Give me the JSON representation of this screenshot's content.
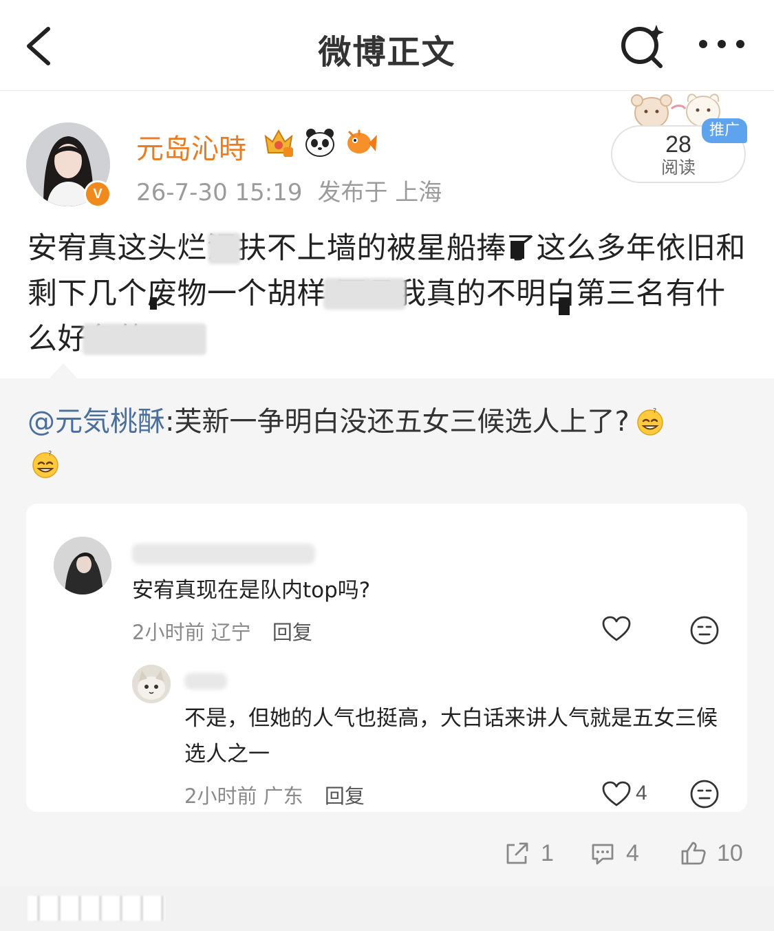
{
  "nav": {
    "title": "微博正文",
    "back_icon": "chevron-left-icon",
    "search_icon": "sparkle-search-icon",
    "more_icon": "more-horizontal-icon"
  },
  "post": {
    "author": "元岛沁時",
    "author_color": "#ec7a1e",
    "verified_badge": "V",
    "badges": [
      "crown-member-icon",
      "panda-icon",
      "orange-fish-icon"
    ],
    "date": "26-7-30 15:19",
    "location": "发布于 上海",
    "read_count": "28",
    "read_label": "阅读",
    "promo_tag": "推广",
    "text": "安宥真这头烂泥扶不上墙的被星船捧了这么多年依旧和剩下几个废物一个胡样 而且我真的不明白第三名有什么好争的"
  },
  "repost": {
    "user": "@元気桃酥",
    "text": ":芙新一争明白没还五女三候选人上了?",
    "emoji": "dizzy-smile-emoji"
  },
  "comments": [
    {
      "text": "安宥真现在是队内top吗?",
      "time": "2小时前",
      "location": "辽宁",
      "reply_label": "回复",
      "likes": ""
    },
    {
      "text": "不是，但她的人气也挺高，大白话来讲人气就是五女三候选人之一",
      "time": "2小时前",
      "location": "广东",
      "reply_label": "回复",
      "likes": "4"
    }
  ],
  "actions": {
    "repost_count": "1",
    "comment_count": "4",
    "like_count": "10"
  }
}
